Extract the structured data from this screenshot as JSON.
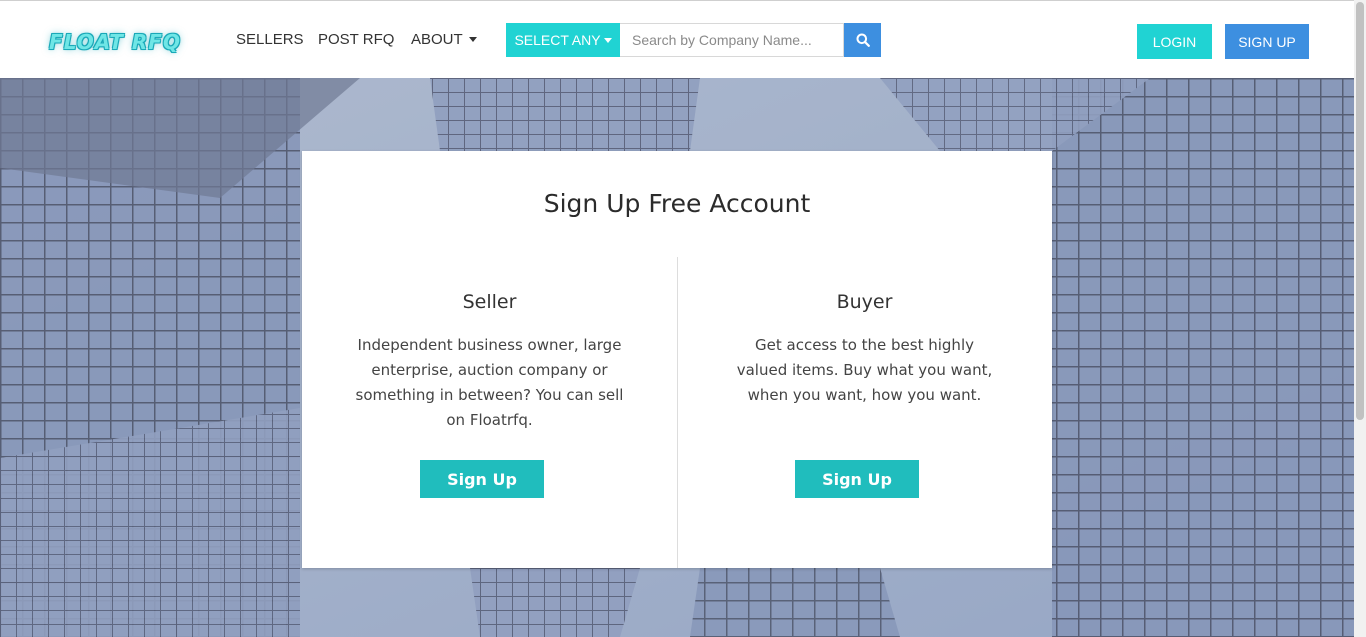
{
  "logo": {
    "text": "FLOAT RFQ"
  },
  "nav": {
    "sellers": "SELLERS",
    "post_rfq": "POST RFQ",
    "about": "ABOUT"
  },
  "search": {
    "select_label": "SELECT ANY",
    "placeholder": "Search by Company Name...",
    "button_icon": "search-icon"
  },
  "auth": {
    "login": "LOGIN",
    "signup": "SIGN UP"
  },
  "card": {
    "title": "Sign Up Free Account",
    "seller": {
      "title": "Seller",
      "description": "Independent business owner, large enterprise, auction company or something in between? You can sell on Floatrfq.",
      "button": "Sign Up"
    },
    "buyer": {
      "title": "Buyer",
      "description": "Get access to the best highly valued items. Buy what you want, when you want, how you want.",
      "button": "Sign Up"
    }
  },
  "colors": {
    "accent_cyan": "#20d3d3",
    "accent_blue": "#3d8fe0",
    "button_teal": "#20bdbd"
  }
}
